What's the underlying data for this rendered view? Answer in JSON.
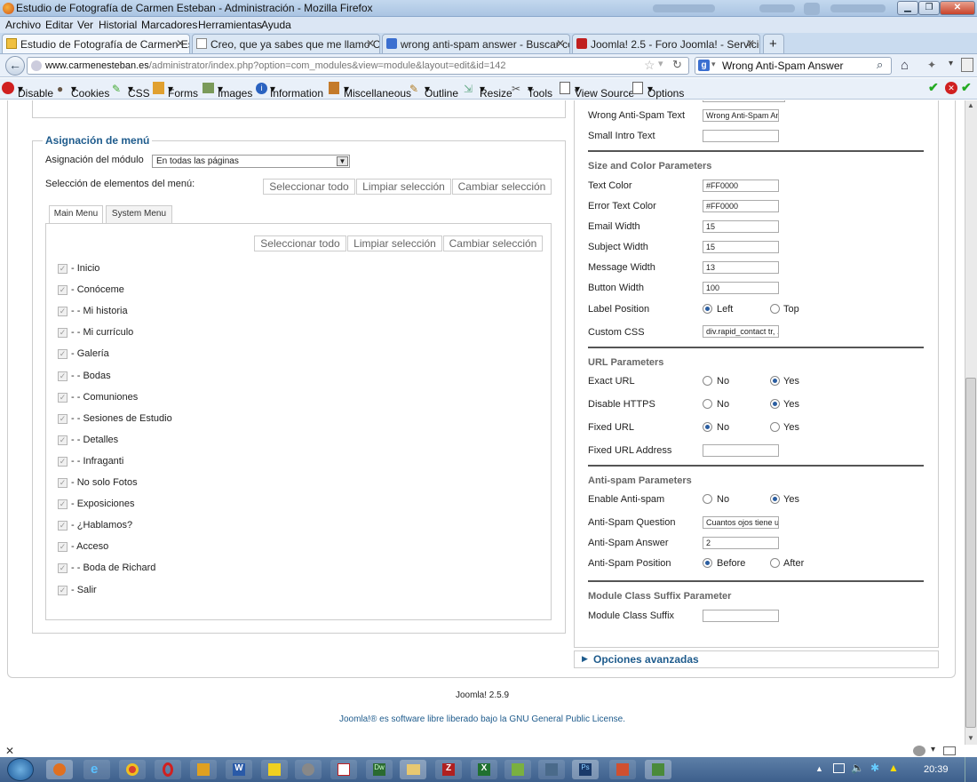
{
  "window": {
    "title": "Estudio de Fotografía de Carmen Esteban - Administración - Mozilla Firefox"
  },
  "menubar": [
    "Archivo",
    "Editar",
    "Ver",
    "Historial",
    "Marcadores",
    "Herramientas",
    "Ayuda"
  ],
  "tabs": [
    {
      "label": "Estudio de Fotografía de Carmen Este...",
      "active": true
    },
    {
      "label": "Creo, que ya sabes que me llamo Car...",
      "active": false
    },
    {
      "label": "wrong anti-spam answer - Buscar co...",
      "active": false
    },
    {
      "label": "Joomla! 2.5 - Foro Joomla! - Servicios ...",
      "active": false
    }
  ],
  "url": {
    "domain": "www.carmenesteban.es",
    "path": "/administrator/index.php?option=com_modules&view=module&layout=edit&id=142"
  },
  "search": {
    "value": "Wrong Anti-Spam Answer"
  },
  "webdev": [
    "Disable",
    "Cookies",
    "CSS",
    "Forms",
    "Images",
    "Information",
    "Miscellaneous",
    "Outline",
    "Resize",
    "Tools",
    "View Source",
    "Options"
  ],
  "menu_assignment": {
    "legend": "Asignación de menú",
    "module_label": "Asignación del módulo",
    "module_value": "En todas las páginas",
    "selection_label": "Selección de elementos del menú:",
    "buttons": [
      "Seleccionar todo",
      "Limpiar selección",
      "Cambiar selección"
    ],
    "tabs": [
      "Main Menu",
      "System Menu"
    ],
    "items": [
      "- Inicio",
      "- Conóceme",
      "- - Mi historia",
      "- - Mi currículo",
      "- Galería",
      "- - Bodas",
      "- - Comuniones",
      "- - Sesiones de Estudio",
      "- - Detalles",
      "- - Infraganti",
      "- No solo Fotos",
      "- Exposiciones",
      "- ¿Hablamos?",
      "- Acceso",
      "- - Boda de Richard",
      "- Salir"
    ]
  },
  "params": {
    "wrong_text": {
      "label": "Wrong Anti-Spam Text",
      "value": "Wrong Anti-Spam An"
    },
    "small_intro": {
      "label": "Small Intro Text",
      "value": ""
    },
    "size_color_title": "Size and Color Parameters",
    "text_color": {
      "label": "Text Color",
      "value": "#FF0000"
    },
    "error_color": {
      "label": "Error Text Color",
      "value": "#FF0000"
    },
    "email_width": {
      "label": "Email Width",
      "value": "15"
    },
    "subject_width": {
      "label": "Subject Width",
      "value": "15"
    },
    "message_width": {
      "label": "Message Width",
      "value": "13"
    },
    "button_width": {
      "label": "Button Width",
      "value": "100"
    },
    "label_position": {
      "label": "Label Position",
      "opt1": "Left",
      "opt2": "Top"
    },
    "custom_css": {
      "label": "Custom CSS",
      "value": "div.rapid_contact tr, ."
    },
    "url_title": "URL Parameters",
    "exact_url": {
      "label": "Exact URL"
    },
    "disable_https": {
      "label": "Disable HTTPS"
    },
    "fixed_url": {
      "label": "Fixed URL"
    },
    "fixed_url_address": {
      "label": "Fixed URL Address",
      "value": ""
    },
    "antispam_title": "Anti-spam Parameters",
    "enable_antispam": {
      "label": "Enable Anti-spam"
    },
    "antispam_question": {
      "label": "Anti-Spam Question",
      "value": "Cuantos ojos tiene u"
    },
    "antispam_answer": {
      "label": "Anti-Spam Answer",
      "value": "2"
    },
    "antispam_position": {
      "label": "Anti-Spam Position",
      "opt1": "Before",
      "opt2": "After"
    },
    "suffix_title": "Module Class Suffix Parameter",
    "suffix": {
      "label": "Module Class Suffix",
      "value": ""
    },
    "no": "No",
    "yes": "Yes",
    "advanced": "Opciones avanzadas"
  },
  "footer": {
    "version": "Joomla! 2.5.9",
    "license_pre": "Joomla!® es software libre liberado bajo la ",
    "license_link": "GNU General Public License",
    "license_post": "."
  },
  "taskbar": {
    "time": "20:39"
  }
}
